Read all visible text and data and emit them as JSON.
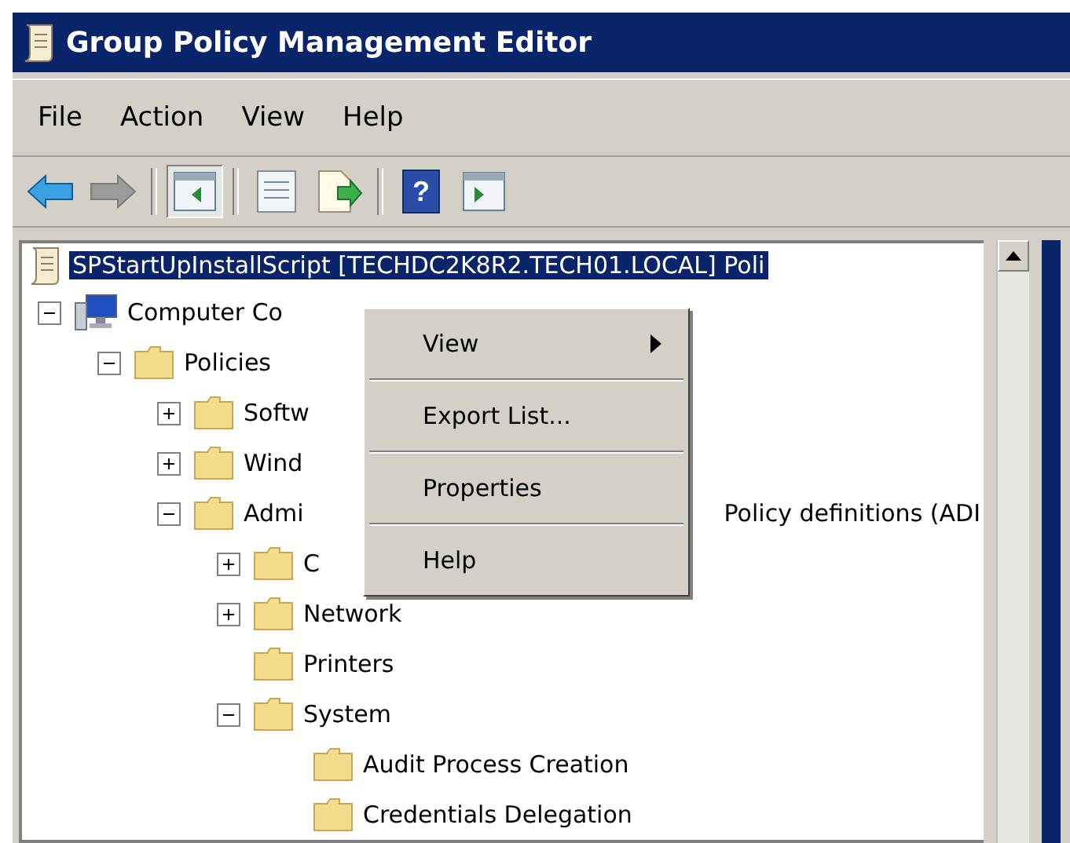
{
  "window": {
    "title": "Group Policy Management Editor"
  },
  "menu_bar": [
    "File",
    "Action",
    "View",
    "Help"
  ],
  "toolbar": [
    {
      "kind": "back",
      "disabled": false,
      "pressed": false
    },
    {
      "kind": "forward",
      "disabled": true,
      "pressed": false
    },
    {
      "kind": "separator"
    },
    {
      "kind": "tree-pane",
      "disabled": false,
      "pressed": true
    },
    {
      "kind": "separator"
    },
    {
      "kind": "properties",
      "disabled": false,
      "pressed": false
    },
    {
      "kind": "export",
      "disabled": false,
      "pressed": false
    },
    {
      "kind": "separator"
    },
    {
      "kind": "help",
      "glyph": "?",
      "disabled": false,
      "pressed": false
    },
    {
      "kind": "action-pane",
      "disabled": false,
      "pressed": false
    }
  ],
  "tree": {
    "root": {
      "label": "SPStartUpInstallScript [TECHDC2K8R2.TECH01.LOCAL] Poli",
      "selected": true
    },
    "items": [
      {
        "label": "Computer Co",
        "kind": "computer",
        "expanded": true,
        "children": [
          {
            "label": "Policies",
            "kind": "folder",
            "expanded": true,
            "children": [
              {
                "label": "Softw",
                "kind": "folder",
                "expanded": false
              },
              {
                "label": "Wind",
                "kind": "folder",
                "expanded": false
              },
              {
                "label": "Admi",
                "tail": "Policy definitions (ADI",
                "kind": "folder",
                "expanded": true,
                "children": [
                  {
                    "label": "C",
                    "kind": "folder",
                    "expanded": false
                  },
                  {
                    "label": "Network",
                    "kind": "folder",
                    "expanded": false
                  },
                  {
                    "label": "Printers",
                    "kind": "folder"
                  },
                  {
                    "label": "System",
                    "kind": "folder",
                    "expanded": true,
                    "children": [
                      {
                        "label": "Audit Process Creation",
                        "kind": "folder"
                      },
                      {
                        "label": "Credentials Delegation",
                        "kind": "folder"
                      }
                    ]
                  }
                ]
              }
            ]
          }
        ]
      }
    ]
  },
  "context_menu": [
    {
      "label": "View",
      "submenu": true
    },
    {
      "label": "Export List...",
      "submenu": false
    },
    {
      "label": "Properties",
      "submenu": false
    },
    {
      "label": "Help",
      "submenu": false
    }
  ]
}
